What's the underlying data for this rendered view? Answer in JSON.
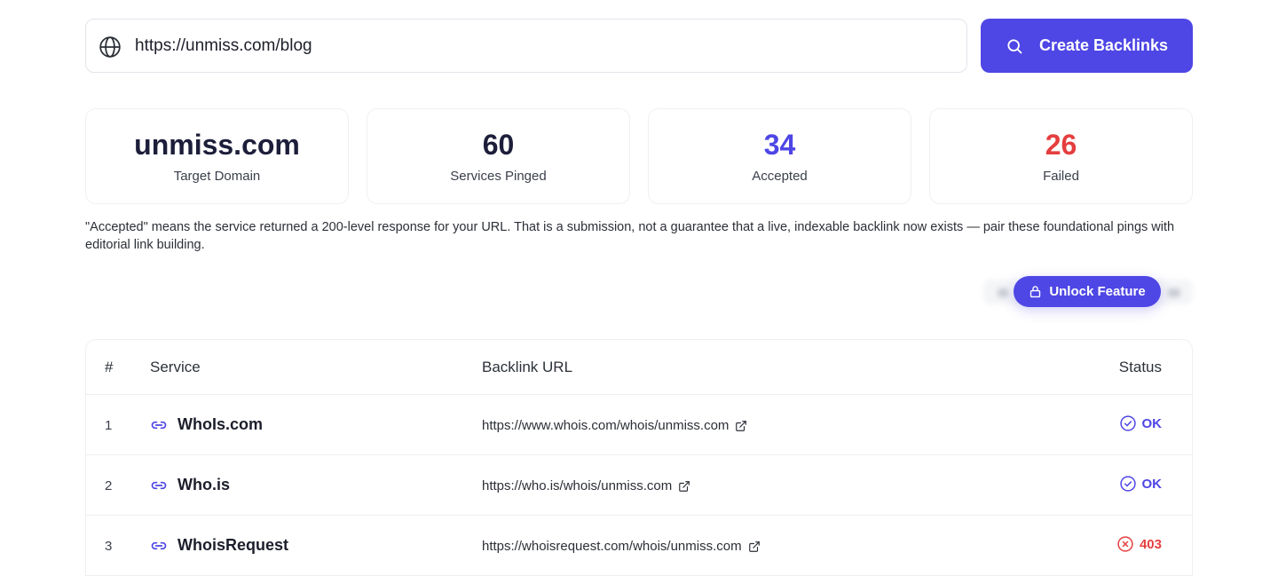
{
  "search": {
    "url_value": "https://unmiss.com/blog",
    "button_label": "Create Backlinks"
  },
  "stats": [
    {
      "value": "unmiss.com",
      "label": "Target Domain",
      "color": "#1c1e3a"
    },
    {
      "value": "60",
      "label": "Services Pinged",
      "color": "#1c1e3a"
    },
    {
      "value": "34",
      "label": "Accepted",
      "color": "#4e46e5"
    },
    {
      "value": "26",
      "label": "Failed",
      "color": "#e53e3e"
    }
  ],
  "note": "\"Accepted\" means the service returned a 200-level response for your URL. That is a submission, not a guarantee that a live, indexable backlink now exists — pair these foundational pings with editorial link building.",
  "unlock": {
    "label": "Unlock Feature"
  },
  "table": {
    "headers": {
      "num": "#",
      "service": "Service",
      "url": "Backlink URL",
      "status": "Status"
    },
    "rows": [
      {
        "num": "1",
        "service": "WhoIs.com",
        "url": "https://www.whois.com/whois/unmiss.com",
        "status": "OK",
        "ok": true
      },
      {
        "num": "2",
        "service": "Who.is",
        "url": "https://who.is/whois/unmiss.com",
        "status": "OK",
        "ok": true
      },
      {
        "num": "3",
        "service": "WhoisRequest",
        "url": "https://whoisrequest.com/whois/unmiss.com",
        "status": "403",
        "ok": false
      }
    ]
  },
  "icons": {
    "globe": "globe-icon",
    "search": "search-icon",
    "lock": "lock-icon",
    "link": "link-icon",
    "external": "external-link-icon",
    "check": "check-circle-icon",
    "error": "x-circle-icon"
  },
  "colors": {
    "accent": "#4e46e5",
    "error": "#e53e3e"
  }
}
